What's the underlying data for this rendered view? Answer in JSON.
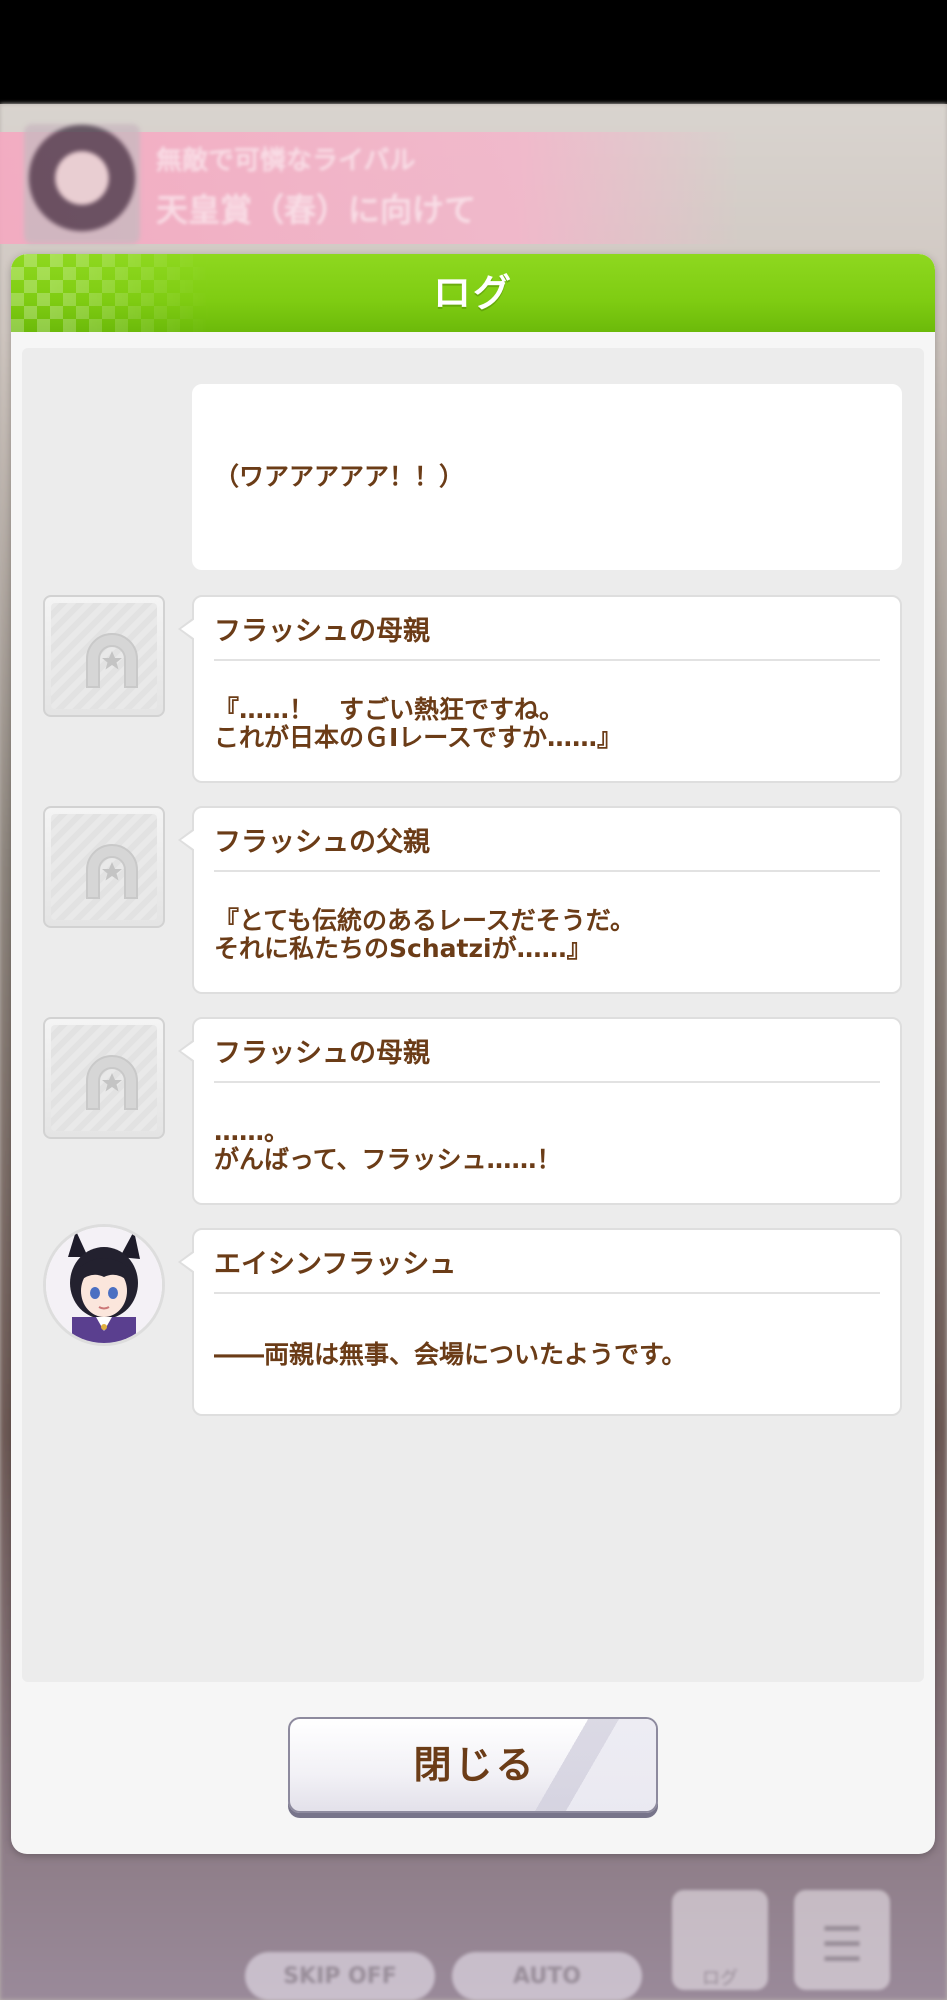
{
  "background": {
    "header_line1": "無敵で可憐なライバル",
    "header_line2": "天皇賞（春）に向けて",
    "footer": {
      "skip_label": "SKIP OFF",
      "auto_label": "AUTO",
      "log_label": "ログ"
    }
  },
  "dialog": {
    "title": "ログ",
    "close_label": "閉じる",
    "accent_color": "#7fcc12",
    "text_color": "#6b3c17"
  },
  "log": [
    {
      "speaker": "",
      "avatar": "none",
      "line1": "（ワアアアアア！！）",
      "line2": ""
    },
    {
      "speaker": "フラッシュの母親",
      "avatar": "horseshoe-icon",
      "line1": "『……！　すごい熱狂ですね。",
      "line2": "これが日本のＧⅠレースですか……』"
    },
    {
      "speaker": "フラッシュの父親",
      "avatar": "horseshoe-icon",
      "line1": "『とても伝統のあるレースだそうだ。",
      "line2": "それに私たちのSchatziが……』"
    },
    {
      "speaker": "フラッシュの母親",
      "avatar": "horseshoe-icon",
      "line1": "……。",
      "line2": "がんばって、フラッシュ……！"
    },
    {
      "speaker": "エイシンフラッシュ",
      "avatar": "character-portrait",
      "line1": "――両親は無事、会場についたようです。",
      "line2": ""
    }
  ]
}
